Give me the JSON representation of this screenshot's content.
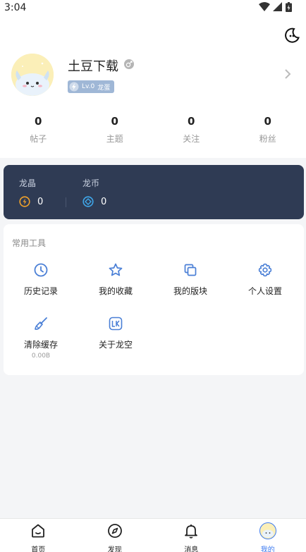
{
  "status_bar": {
    "time": "3:04"
  },
  "profile": {
    "username": "土豆下载",
    "level": "Lv.0",
    "level_title": "龙蛋"
  },
  "stats": [
    {
      "value": "0",
      "label": "帖子"
    },
    {
      "value": "0",
      "label": "主题"
    },
    {
      "value": "0",
      "label": "关注"
    },
    {
      "value": "0",
      "label": "粉丝"
    }
  ],
  "wallet": {
    "crystal_label": "龙晶",
    "crystal_value": "0",
    "coin_label": "龙币",
    "coin_value": "0"
  },
  "tools": {
    "title": "常用工具",
    "items": [
      {
        "label": "历史记录",
        "icon": "clock-icon"
      },
      {
        "label": "我的收藏",
        "icon": "star-icon"
      },
      {
        "label": "我的版块",
        "icon": "copy-icon"
      },
      {
        "label": "个人设置",
        "icon": "gear-icon"
      },
      {
        "label": "清除缓存",
        "sub": "0.00B",
        "icon": "brush-icon"
      },
      {
        "label": "关于龙空",
        "icon": "lk-logo-icon"
      }
    ]
  },
  "tabbar": {
    "items": [
      {
        "label": "首页",
        "icon": "home-icon"
      },
      {
        "label": "发现",
        "icon": "compass-icon"
      },
      {
        "label": "消息",
        "icon": "bell-icon"
      },
      {
        "label": "我的",
        "icon": "avatar-icon"
      }
    ],
    "active_index": 3
  },
  "colors": {
    "accent": "#3d7bf0",
    "icon_blue": "#4a7fd6",
    "wallet_bg": "#2f3b54",
    "crystal_orange": "#f1a22a",
    "coin_blue": "#3fa7ea"
  }
}
